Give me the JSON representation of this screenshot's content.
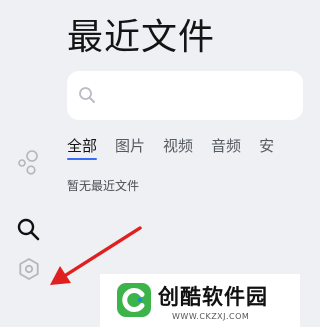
{
  "header": {
    "title": "最近文件"
  },
  "search": {
    "placeholder": "",
    "value": ""
  },
  "tabs": [
    {
      "label": "全部",
      "active": true
    },
    {
      "label": "图片",
      "active": false
    },
    {
      "label": "视频",
      "active": false
    },
    {
      "label": "音频",
      "active": false
    },
    {
      "label": "安",
      "active": false
    }
  ],
  "main": {
    "empty_text": "暂无最近文件"
  },
  "sidebar": {
    "icons": [
      "bubbles-icon",
      "search-icon",
      "settings-icon"
    ]
  },
  "watermark": {
    "name": "创酷软件园",
    "url": "WWW.CKZXJ.COM"
  },
  "colors": {
    "background": "#eff0f4",
    "accent": "#3a6cf5",
    "annotation_arrow": "#e02020",
    "logo_green": "#3cb44a"
  }
}
